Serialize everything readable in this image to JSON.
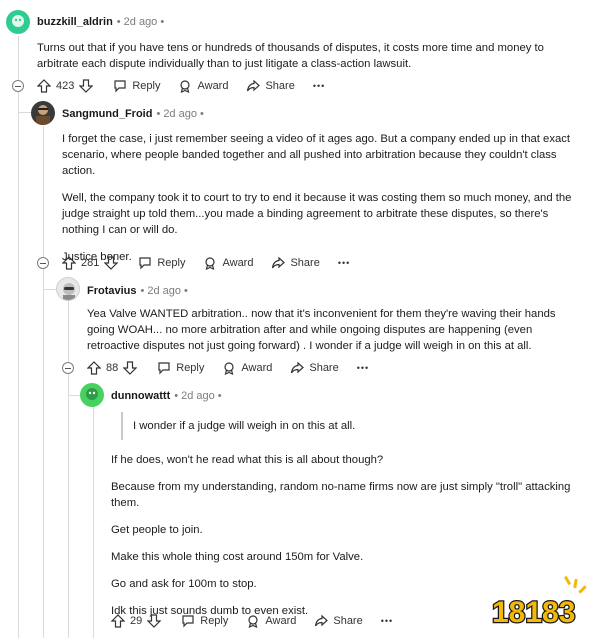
{
  "comments": [
    {
      "user": "buzzkill_aldrin",
      "time": "2d ago",
      "paragraphs": [
        "Turns out that if you have tens or hundreds of thousands of disputes, it costs more time and money to arbitrate each dispute individually than to just litigate a class-action lawsuit."
      ],
      "votes": "423"
    },
    {
      "user": "Sangmund_Froid",
      "time": "2d ago",
      "paragraphs": [
        "I forget the case, i just remember seeing a video of it ages ago. But a company ended up in that exact scenario, where people banded together and all pushed into arbitration because they couldn't class action.",
        "Well, the company took it to court to try to end it because it was costing them so much money, and the judge straight up told them...you made a binding agreement to arbitrate these disputes, so there's nothing I can or will do.",
        "Justice boner."
      ],
      "votes": "281"
    },
    {
      "user": "Frotavius",
      "time": "2d ago",
      "paragraphs": [
        "Yea Valve WANTED arbitration.. now that it's inconvenient for them they're waving their hands going WOAH... no more arbitration after and while ongoing disputes are happening (even retroactive disputes not just going forward) . I wonder if a judge will weigh in on this at all."
      ],
      "votes": "88"
    },
    {
      "user": "dunnowattt",
      "time": "2d ago",
      "quote": "I wonder if a judge will weigh in on this at all.",
      "paragraphs": [
        "If he does, won't he read what this is all about though?",
        "Because from my understanding, random no-name firms now are just simply \"troll\" attacking them.",
        "Get people to join.",
        "Make this whole thing cost around 150m for Valve.",
        "Go and ask for 100m to stop.",
        "Idk this just sounds dumb to even exist."
      ],
      "votes": "29"
    }
  ],
  "labels": {
    "reply": "Reply",
    "award": "Award",
    "share": "Share",
    "more": "•••",
    "dot": "•"
  },
  "watermark": {
    "text": "18183"
  },
  "colors": {
    "thread_line": "#d8dadc",
    "meta_gray": "#7c7c7c",
    "logo_gold": "#f2b90a"
  }
}
